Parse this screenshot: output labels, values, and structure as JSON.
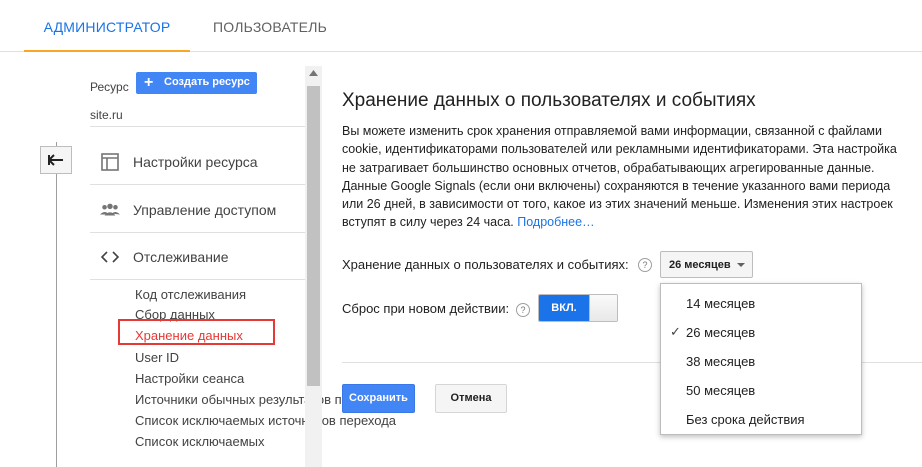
{
  "tabs": {
    "admin": "АДМИНИСТРАТОР",
    "user": "ПОЛЬЗОВАТЕЛЬ"
  },
  "sidebar": {
    "resource_label": "Ресурс",
    "create_button": "Создать ресурс",
    "site": "site.ru",
    "menu": [
      {
        "label": "Настройки ресурса",
        "icon": "layout-icon"
      },
      {
        "label": "Управление доступом",
        "icon": "people-icon"
      },
      {
        "label": "Отслеживание",
        "icon": "code-icon"
      }
    ],
    "sub_items": [
      "Код отслеживания",
      "Сбор данных",
      "Хранение данных",
      "User ID",
      "Настройки сеанса",
      "Источники обычных результатов поиска",
      "Список исключаемых источников перехода",
      "Список исключаемых"
    ],
    "active_sub_item": "Хранение данных"
  },
  "main": {
    "title": "Хранение данных о пользователях и событиях",
    "description": "Вы можете изменить срок хранения отправляемой вами информации, связанной с файлами cookie, идентификаторами пользователей или рекламными идентификаторами. Эта настройка не затрагивает большинство основных отчетов, обрабатывающих агрегированные данные. Данные Google Signals (если они включены) сохраняются в течение указанного вами периода или 26 дней, в зависимости от того, какое из этих значений меньше. Изменения этих настроек вступят в силу через 24 часа.",
    "more_link": "Подробнее…",
    "retention_label": "Хранение данных о пользователях и событиях:",
    "retention_value": "26 месяцев",
    "reset_label": "Сброс при новом действии:",
    "toggle_label": "ВКЛ.",
    "help_symbol": "?",
    "save_button": "Сохранить",
    "cancel_button": "Отмена",
    "dropdown_options": [
      "14 месяцев",
      "26 месяцев",
      "38 месяцев",
      "50 месяцев",
      "Без срока действия"
    ],
    "selected_option": "26 месяцев"
  },
  "colors": {
    "accent": "#1a73e8",
    "tab_underline": "#f9a825",
    "highlight": "#e53935",
    "primary_button": "#4285f4"
  }
}
